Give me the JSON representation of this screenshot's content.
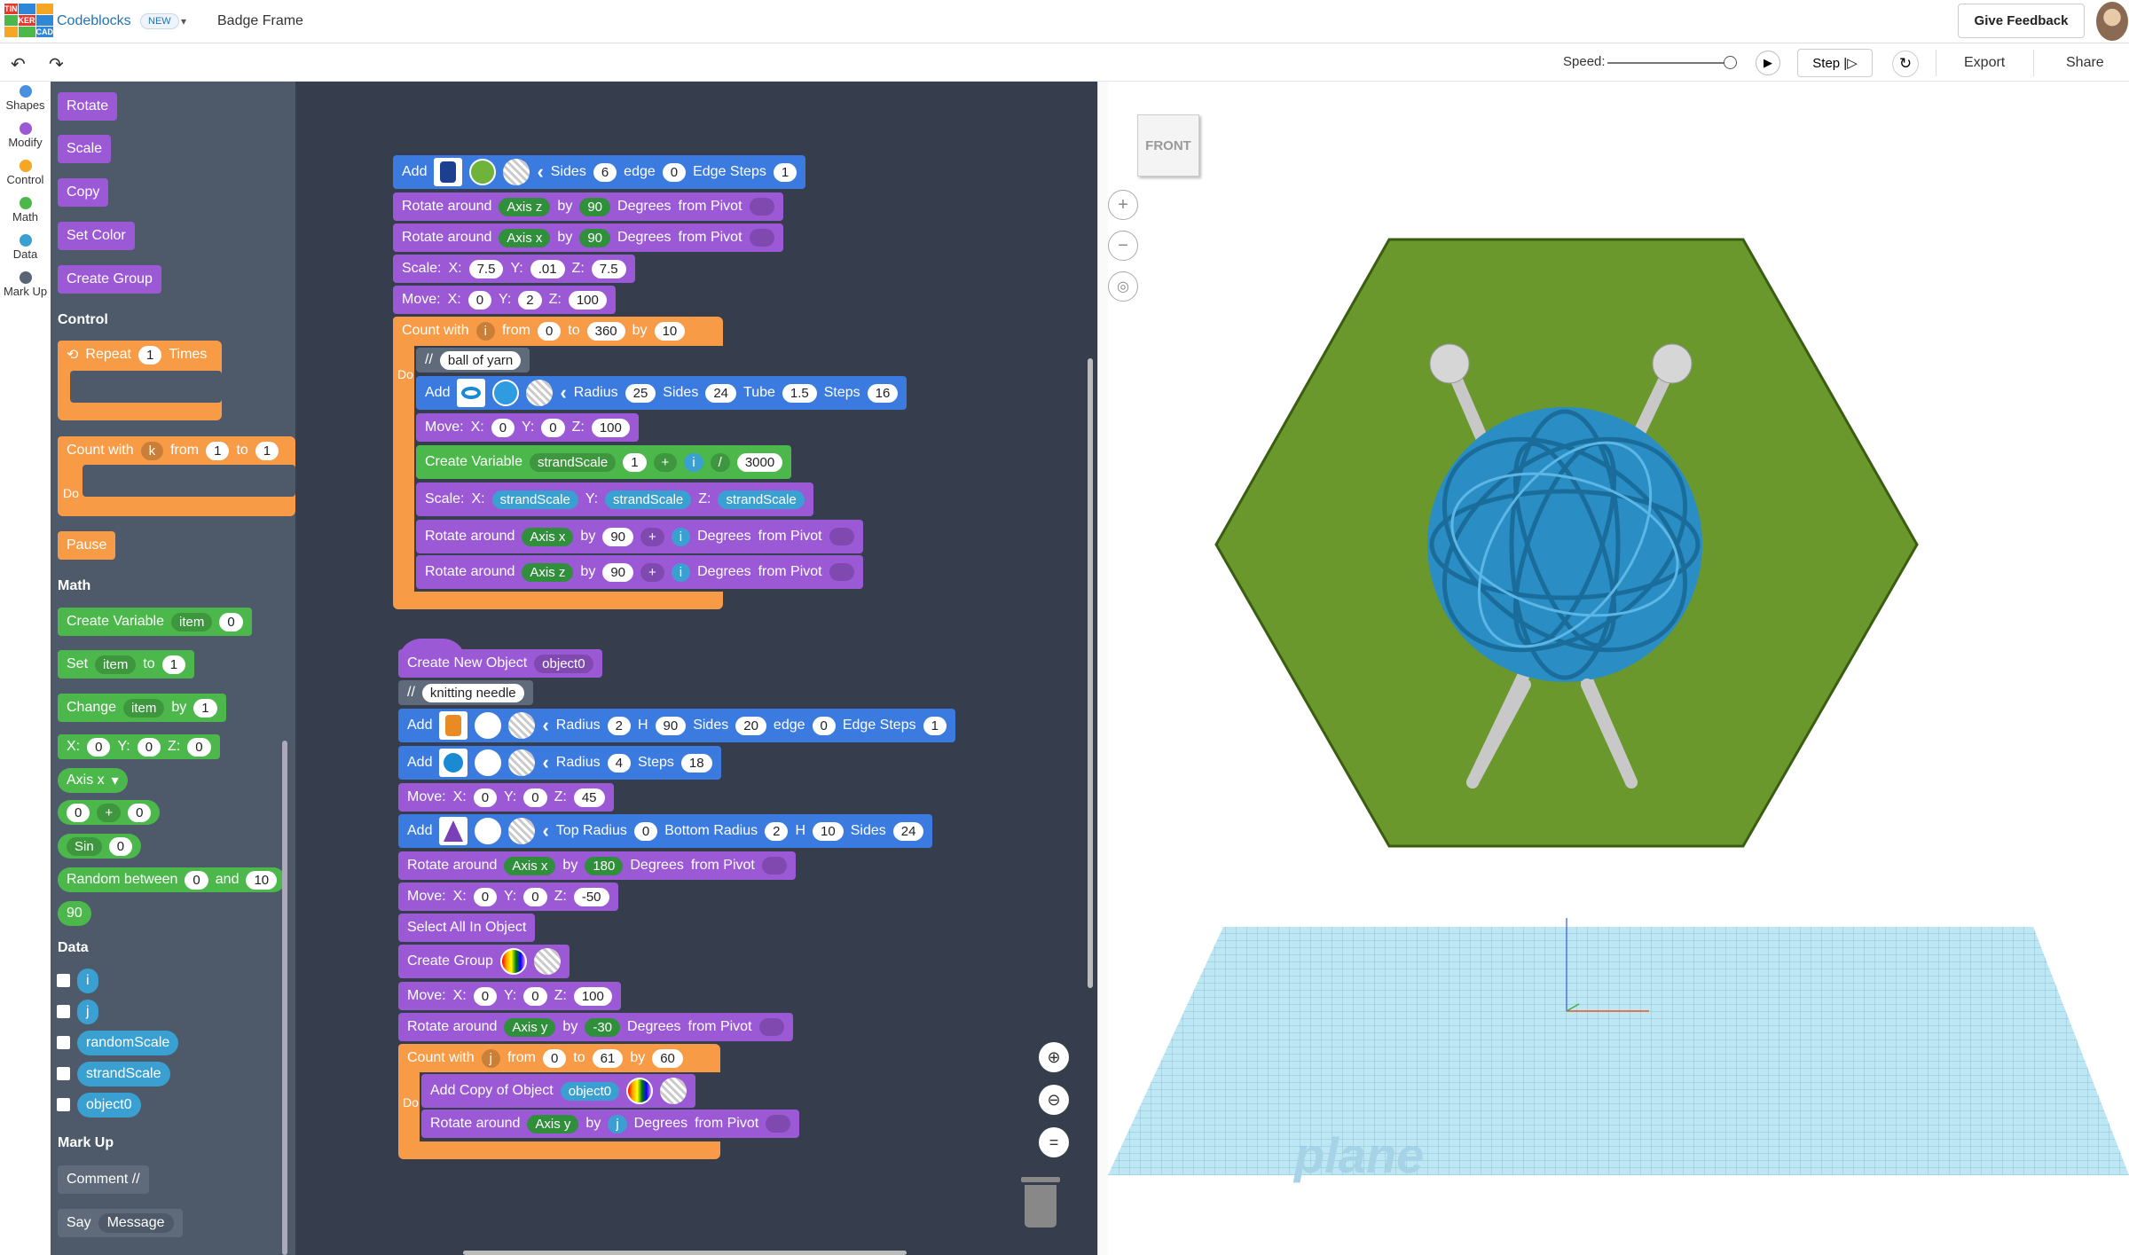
{
  "header": {
    "logo_letters": [
      "TIN",
      "KER",
      "CAD"
    ],
    "app_name": "Codeblocks",
    "new_badge": "NEW",
    "doc_name": "Badge Frame",
    "feedback": "Give Feedback"
  },
  "toolbar": {
    "undo": "↶",
    "redo": "↷",
    "speed_label": "Speed:",
    "speed_level": 1.0,
    "step": "Step",
    "export": "Export",
    "share": "Share"
  },
  "categories": [
    {
      "label": "Shapes",
      "color": "#4a90e2"
    },
    {
      "label": "Modify",
      "color": "#9b59d6"
    },
    {
      "label": "Control",
      "color": "#f5a623"
    },
    {
      "label": "Math",
      "color": "#4cb84c"
    },
    {
      "label": "Data",
      "color": "#3aa0d2"
    },
    {
      "label": "Mark Up",
      "color": "#5a6475"
    }
  ],
  "palette": {
    "modify": [
      "Rotate",
      "Scale",
      "Copy",
      "Set Color",
      "Create Group"
    ],
    "control_title": "Control",
    "repeat": {
      "label": "Repeat",
      "n": "1",
      "times": "Times"
    },
    "count": {
      "label": "Count with",
      "var": "k",
      "from": "from",
      "a": "1",
      "to": "to",
      "b": "1",
      "do": "Do"
    },
    "pause": "Pause",
    "math_title": "Math",
    "create_var": {
      "label": "Create Variable",
      "var": "item",
      "val": "0"
    },
    "set": {
      "label": "Set",
      "var": "item",
      "to": "to",
      "val": "1"
    },
    "change": {
      "label": "Change",
      "var": "item",
      "by": "by",
      "val": "1"
    },
    "xyz": {
      "x": "X:",
      "xv": "0",
      "y": "Y:",
      "yv": "0",
      "z": "Z:",
      "zv": "0"
    },
    "axis": "Axis x",
    "arith": {
      "a": "0",
      "op": "+",
      "b": "0"
    },
    "sin": {
      "fn": "Sin",
      "v": "0"
    },
    "random": {
      "label": "Random between",
      "a": "0",
      "and": "and",
      "b": "10"
    },
    "ninety": "90",
    "data_title": "Data",
    "vars": [
      "i",
      "j",
      "randomScale",
      "strandScale",
      "object0"
    ],
    "markup_title": "Mark Up",
    "comment": "Comment //",
    "say": {
      "label": "Say",
      "msg": "Message"
    }
  },
  "ws": {
    "add1": {
      "add": "Add",
      "sides": "Sides",
      "sv": "6",
      "edge": "edge",
      "ev": "0",
      "es": "Edge Steps",
      "esv": "1"
    },
    "rot1": {
      "l": "Rotate around",
      "axis": "Axis z",
      "by": "by",
      "v": "90",
      "deg": "Degrees",
      "pivot": "from Pivot"
    },
    "rot2": {
      "l": "Rotate around",
      "axis": "Axis x",
      "by": "by",
      "v": "90",
      "deg": "Degrees",
      "pivot": "from Pivot"
    },
    "scale1": {
      "l": "Scale:",
      "x": "X:",
      "xv": "7.5",
      "y": "Y:",
      "yv": ".01",
      "z": "Z:",
      "zv": "7.5"
    },
    "move1": {
      "l": "Move:",
      "x": "X:",
      "xv": "0",
      "y": "Y:",
      "yv": "2",
      "z": "Z:",
      "zv": "100"
    },
    "count1": {
      "l": "Count with",
      "var": "i",
      "from": "from",
      "a": "0",
      "to": "to",
      "b": "360",
      "by": "by",
      "c": "10",
      "do": "Do"
    },
    "comment1": {
      "slash": "//",
      "text": "ball of yarn"
    },
    "add2": {
      "add": "Add",
      "radius": "Radius",
      "rv": "25",
      "sides": "Sides",
      "sv": "24",
      "tube": "Tube",
      "tv": "1.5",
      "steps": "Steps",
      "stv": "16"
    },
    "move2": {
      "l": "Move:",
      "x": "X:",
      "xv": "0",
      "y": "Y:",
      "yv": "0",
      "z": "Z:",
      "zv": "100"
    },
    "cvar": {
      "l": "Create Variable",
      "var": "strandScale",
      "a": "1",
      "op": "+",
      "i": "i",
      "op2": "/",
      "b": "3000"
    },
    "scale2": {
      "l": "Scale:",
      "x": "X:",
      "xv": "strandScale",
      "y": "Y:",
      "yv": "strandScale",
      "z": "Z:",
      "zv": "strandScale"
    },
    "rot3": {
      "l": "Rotate around",
      "axis": "Axis x",
      "by": "by",
      "v": "90",
      "op": "+",
      "i": "i",
      "deg": "Degrees",
      "pivot": "from Pivot"
    },
    "rot4": {
      "l": "Rotate around",
      "axis": "Axis z",
      "by": "by",
      "v": "90",
      "op": "+",
      "i": "i",
      "deg": "Degrees",
      "pivot": "from Pivot"
    },
    "newobj": {
      "l": "Create New Object",
      "var": "object0"
    },
    "comment2": {
      "slash": "//",
      "text": "knitting needle"
    },
    "add3": {
      "add": "Add",
      "radius": "Radius",
      "rv": "2",
      "h": "H",
      "hv": "90",
      "sides": "Sides",
      "sv": "20",
      "edge": "edge",
      "ev": "0",
      "es": "Edge Steps",
      "esv": "1"
    },
    "add4": {
      "add": "Add",
      "radius": "Radius",
      "rv": "4",
      "steps": "Steps",
      "sv": "18"
    },
    "move3": {
      "l": "Move:",
      "x": "X:",
      "xv": "0",
      "y": "Y:",
      "yv": "0",
      "z": "Z:",
      "zv": "45"
    },
    "add5": {
      "add": "Add",
      "tr": "Top Radius",
      "trv": "0",
      "br": "Bottom Radius",
      "brv": "2",
      "h": "H",
      "hv": "10",
      "sides": "Sides",
      "sv": "24"
    },
    "rot5": {
      "l": "Rotate around",
      "axis": "Axis x",
      "by": "by",
      "v": "180",
      "deg": "Degrees",
      "pivot": "from Pivot"
    },
    "move4": {
      "l": "Move:",
      "x": "X:",
      "xv": "0",
      "y": "Y:",
      "yv": "0",
      "z": "Z:",
      "zv": "-50"
    },
    "selall": "Select All In Object",
    "group": "Create Group",
    "move5": {
      "l": "Move:",
      "x": "X:",
      "xv": "0",
      "y": "Y:",
      "yv": "0",
      "z": "Z:",
      "zv": "100"
    },
    "rot6": {
      "l": "Rotate around",
      "axis": "Axis y",
      "by": "by",
      "v": "-30",
      "deg": "Degrees",
      "pivot": "from Pivot"
    },
    "count2": {
      "l": "Count with",
      "var": "j",
      "from": "from",
      "a": "0",
      "to": "to",
      "b": "61",
      "by": "by",
      "c": "60",
      "do": "Do"
    },
    "addcopy": {
      "l": "Add Copy of Object",
      "var": "object0"
    },
    "rot7": {
      "l": "Rotate around",
      "axis": "Axis y",
      "by": "by",
      "j": "j",
      "deg": "Degrees",
      "pivot": "from Pivot"
    }
  },
  "viewport": {
    "front": "FRONT",
    "plane_text": "Workplane"
  }
}
